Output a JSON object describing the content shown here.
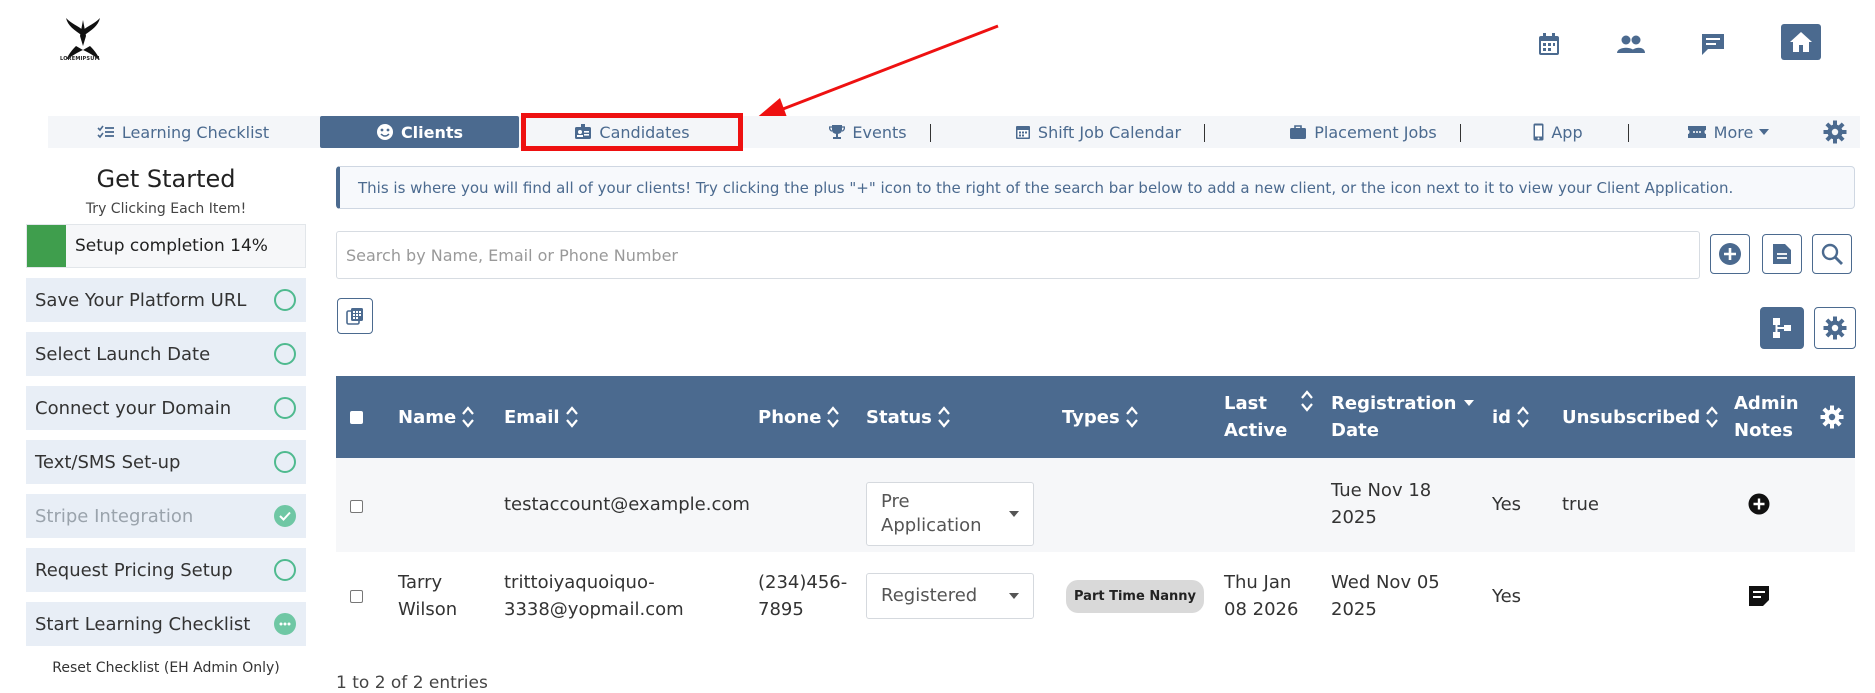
{
  "header": {
    "logo_text": "LOREMIPSUM",
    "icons": [
      "calendar-icon",
      "people-icon",
      "chat-icon",
      "home-icon"
    ]
  },
  "nav": {
    "tabs": [
      {
        "label": "Learning Checklist",
        "icon": "checklist-icon"
      },
      {
        "label": "Clients",
        "icon": "smile-icon",
        "active": true
      },
      {
        "label": "Candidates",
        "icon": "id-card-icon"
      },
      {
        "label": "Events",
        "icon": "trophy-icon"
      },
      {
        "label": "Shift Job Calendar",
        "icon": "calendar-icon"
      },
      {
        "label": "Placement Jobs",
        "icon": "briefcase-icon"
      },
      {
        "label": "App",
        "icon": "phone-icon"
      },
      {
        "label": "More",
        "icon": "ticket-icon"
      }
    ]
  },
  "sidebar": {
    "title": "Get Started",
    "subtitle": "Try Clicking Each Item!",
    "progress_label": "Setup completion 14%",
    "progress_percent": 14,
    "items": [
      {
        "label": "Save Your Platform URL",
        "state": "todo"
      },
      {
        "label": "Select Launch Date",
        "state": "todo"
      },
      {
        "label": "Connect your Domain",
        "state": "todo"
      },
      {
        "label": "Text/SMS Set-up",
        "state": "todo"
      },
      {
        "label": "Stripe Integration",
        "state": "done"
      },
      {
        "label": "Request Pricing Setup",
        "state": "todo"
      },
      {
        "label": "Start Learning Checklist",
        "state": "in-progress"
      }
    ],
    "reset_label": "Reset Checklist (EH Admin Only)"
  },
  "main": {
    "info_text": "This is where you will find all of your clients! Try clicking the plus \"+\" icon to the right of the search bar below to add a new client, or the icon next to it to view your Client Application.",
    "search_placeholder": "Search by Name, Email or Phone Number",
    "columns": {
      "name": "Name",
      "email": "Email",
      "phone": "Phone",
      "status": "Status",
      "types": "Types",
      "last_active_1": "Last",
      "last_active_2": "Active",
      "reg_1": "Registration",
      "reg_2": "Date",
      "id": "id",
      "unsubscribed": "Unsubscribed",
      "notes_1": "Admin",
      "notes_2": "Notes"
    },
    "rows": [
      {
        "name_1": "",
        "name_2": "",
        "email_1": "testaccount@example.com",
        "email_2": "",
        "phone_1": "",
        "phone_2": "",
        "status_1": "Pre",
        "status_2": "Application",
        "type": "",
        "last_1": "",
        "last_2": "",
        "reg_1": "Tue Nov 18",
        "reg_2": "2025",
        "id": "Yes",
        "unsubscribed": "true"
      },
      {
        "name_1": "Tarry",
        "name_2": "Wilson",
        "email_1": "trittoiyaquoiquo-",
        "email_2": "3338@yopmail.com",
        "phone_1": "(234)456-",
        "phone_2": "7895",
        "status_1": "Registered",
        "status_2": "",
        "type": "Part Time Nanny",
        "last_1": "Thu Jan",
        "last_2": "08 2026",
        "reg_1": "Wed Nov 05",
        "reg_2": "2025",
        "id": "Yes",
        "unsubscribed": ""
      }
    ],
    "footer": "1 to 2 of 2 entries"
  },
  "colors": {
    "primary": "#4b6a8f",
    "highlight": "#ee1111",
    "progress": "#3f9e4d",
    "check": "#4fba8f"
  }
}
